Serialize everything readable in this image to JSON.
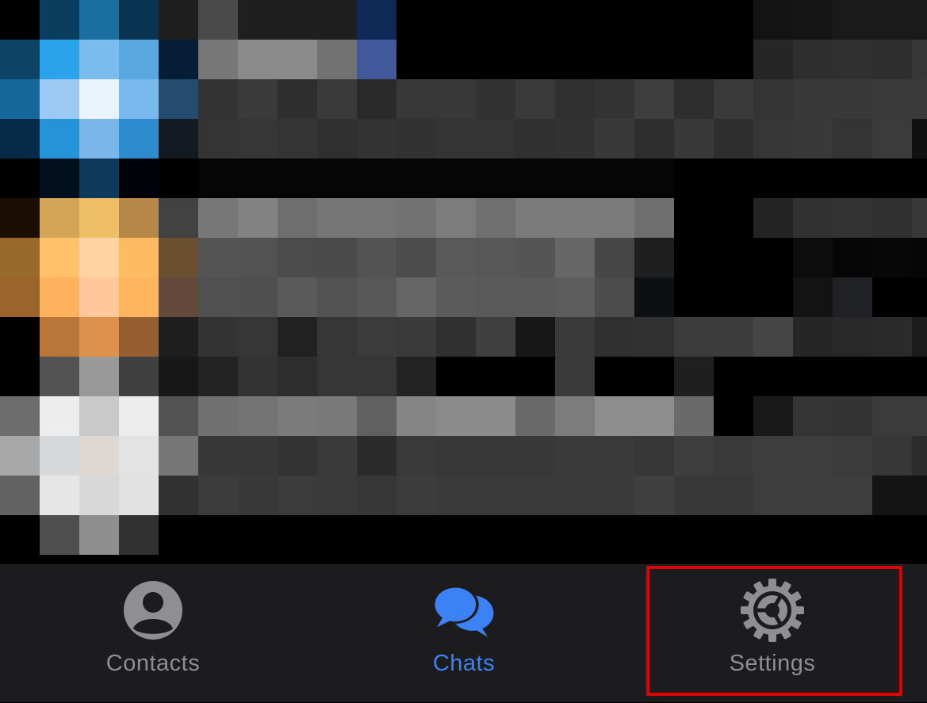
{
  "tab_bar": {
    "active_color": "#3b82f6",
    "inactive_color": "#8e8e93",
    "tabs": [
      {
        "label": "Contacts",
        "icon": "person-circle-icon",
        "active": false
      },
      {
        "label": "Chats",
        "icon": "chat-bubbles-icon",
        "active": true
      },
      {
        "label": "Settings",
        "icon": "gear-icon",
        "active": false
      }
    ]
  },
  "highlight": {
    "target": "Settings",
    "color": "#e00000"
  },
  "pixelated_content": {
    "colors": [
      [
        "#000000",
        "#0b3d5e",
        "#1a6ea0",
        "#093552",
        "#1f1f1f",
        "#4a4a4a",
        "#1f1f1f",
        "#1f1f1f",
        "#1f1f1f",
        "#0f2a56",
        "#000000",
        "#000000",
        "#000000",
        "#000000",
        "#000000",
        "#000000",
        "#000000",
        "#000000",
        "#000000",
        "#131313",
        "#151515",
        "#1a1a1a",
        "#1a1a1a",
        "#1a1a1a"
      ],
      [
        "#0d4466",
        "#2aa3ea",
        "#7bbcee",
        "#5aa8e0",
        "#061e35",
        "#777777",
        "#8a8a8a",
        "#8a8a8a",
        "#727272",
        "#41599a",
        "#000000",
        "#000000",
        "#000000",
        "#000000",
        "#000000",
        "#000000",
        "#000000",
        "#000000",
        "#000000",
        "#262626",
        "#2e2e2e",
        "#303030",
        "#2e2e2e",
        "#363636"
      ],
      [
        "#16679c",
        "#9cc9f2",
        "#e9f3fb",
        "#79b9ee",
        "#234c6e",
        "#333333",
        "#3a3a3a",
        "#2e2e2e",
        "#3a3a3a",
        "#2a2a2a",
        "#383838",
        "#383838",
        "#323232",
        "#3a3a3a",
        "#303030",
        "#333333",
        "#3e3e3e",
        "#2e2e2e",
        "#3a3a3a",
        "#343434",
        "#393939",
        "#393939",
        "#3a3a3a",
        "#3a3a3a"
      ],
      [
        "#072b48",
        "#2593d7",
        "#7ab6e9",
        "#2d8cce",
        "#141a22",
        "#343434",
        "#363636",
        "#343434",
        "#2f2f2f",
        "#333333",
        "#323232",
        "#343434",
        "#343434",
        "#303030",
        "#323232",
        "#393939",
        "#2e2e2e",
        "#393939",
        "#2e2e2e",
        "#363636",
        "#393939",
        "#343434",
        "#3b3b3b",
        "#111111"
      ],
      [
        "#000000",
        "#02101e",
        "#0d3a5c",
        "#000209",
        "#000000",
        "#050505",
        "#050505",
        "#050505",
        "#050505",
        "#050505",
        "#050505",
        "#050505",
        "#050505",
        "#050505",
        "#050505",
        "#050505",
        "#050505",
        "#000000",
        "#000000",
        "#000000",
        "#000000",
        "#000000",
        "#000000",
        "#000000"
      ],
      [
        "#1b0f05",
        "#d4a458",
        "#eebf65",
        "#b58848",
        "#424242",
        "#777777",
        "#828282",
        "#6e6e6e",
        "#767676",
        "#767676",
        "#727272",
        "#7c7c7c",
        "#707070",
        "#7b7b7b",
        "#7b7b7b",
        "#7b7b7b",
        "#6e6e6e",
        "#000000",
        "#000000",
        "#232323",
        "#313131",
        "#333333",
        "#2f2f2f",
        "#393939"
      ],
      [
        "#9a6a2c",
        "#ffc16a",
        "#ffd3a4",
        "#ffbb61",
        "#6a4f31",
        "#545454",
        "#525252",
        "#4b4b4b",
        "#4a4a4a",
        "#535353",
        "#4c4c4c",
        "#595959",
        "#575757",
        "#555555",
        "#666666",
        "#474747",
        "#1f1f1f",
        "#000000",
        "#000000",
        "#000000",
        "#0d0d0d",
        "#050505",
        "#070707",
        "#050505"
      ],
      [
        "#9a642a",
        "#ffb25e",
        "#ffc79b",
        "#ffb45e",
        "#644839",
        "#505050",
        "#4f4f4f",
        "#5a5a5a",
        "#525252",
        "#575757",
        "#666666",
        "#5b5b5b",
        "#595959",
        "#5a5a5a",
        "#5d5d5d",
        "#4c4c4c",
        "#0d1012",
        "#000000",
        "#000000",
        "#000000",
        "#131313",
        "#1f2124",
        "#000000",
        "#000000"
      ],
      [
        "#000000",
        "#b87639",
        "#dc914c",
        "#955f31",
        "#1f1f1f",
        "#333333",
        "#363636",
        "#212121",
        "#363636",
        "#3b3b3b",
        "#3a3a3a",
        "#303030",
        "#404040",
        "#171717",
        "#3a3a3a",
        "#303030",
        "#313131",
        "#3c3c3c",
        "#3c3c3c",
        "#454545",
        "#262626",
        "#282828",
        "#2b2b2b",
        "#1c1c1c"
      ],
      [
        "#000000",
        "#535353",
        "#999999",
        "#404040",
        "#171717",
        "#232323",
        "#333333",
        "#2d2d2d",
        "#363636",
        "#363636",
        "#232323",
        "#000000",
        "#000000",
        "#000000",
        "#3a3a3a",
        "#000000",
        "#000000",
        "#1f1f1f",
        "#000000",
        "#000000",
        "#000000",
        "#000000",
        "#000000",
        "#000000"
      ],
      [
        "#6d6d6d",
        "#ededed",
        "#c9c9c9",
        "#ececec",
        "#535353",
        "#717171",
        "#747474",
        "#7b7b7b",
        "#797979",
        "#606060",
        "#858585",
        "#8b8b8b",
        "#8b8b8b",
        "#6a6a6a",
        "#7c7c7c",
        "#8e8e8e",
        "#8e8e8e",
        "#6a6a6a",
        "#000000",
        "#191919",
        "#343434",
        "#333333",
        "#3b3b3b",
        "#3b3b3b"
      ],
      [
        "#a8a8a8",
        "#d6d9dc",
        "#ded8d2",
        "#e3e3e3",
        "#767676",
        "#373737",
        "#373737",
        "#333333",
        "#3a3a3a",
        "#2b2b2b",
        "#3a3a3a",
        "#383838",
        "#383838",
        "#383838",
        "#3a3a3a",
        "#3a3a3a",
        "#373737",
        "#3e3e3e",
        "#3a3a3a",
        "#3d3d3d",
        "#3d3d3d",
        "#3b3b3b",
        "#373737",
        "#2c2c2c"
      ],
      [
        "#626262",
        "#e6e6e6",
        "#d8d8d8",
        "#e2e2e2",
        "#323232",
        "#3c3c3c",
        "#393939",
        "#3b3b3b",
        "#3a3a3a",
        "#363636",
        "#3c3c3c",
        "#3a3a3a",
        "#3a3a3a",
        "#3a3a3a",
        "#3a3a3a",
        "#3a3a3a",
        "#3f3f3f",
        "#383838",
        "#383838",
        "#3d3d3d",
        "#3d3d3d",
        "#3d3d3d",
        "#141414",
        "#141414"
      ],
      [
        "#000000",
        "#4f4f4f",
        "#8e8e8e",
        "#323232",
        "#000000",
        "#000000",
        "#000000",
        "#000000",
        "#000000",
        "#000000",
        "#000000",
        "#000000",
        "#000000",
        "#000000",
        "#000000",
        "#000000",
        "#000000",
        "#000000",
        "#000000",
        "#000000",
        "#000000",
        "#000000",
        "#000000",
        "#000000"
      ],
      [
        "#000000",
        "#000000",
        "#000000",
        "#000000",
        "#000000",
        "#000000",
        "#000000",
        "#000000",
        "#000000",
        "#000000",
        "#000000",
        "#000000",
        "#000000",
        "#000000",
        "#000000",
        "#000000",
        "#000000",
        "#000000",
        "#000000",
        "#000000",
        "#000000",
        "#000000",
        "#000000",
        "#000000"
      ]
    ]
  }
}
